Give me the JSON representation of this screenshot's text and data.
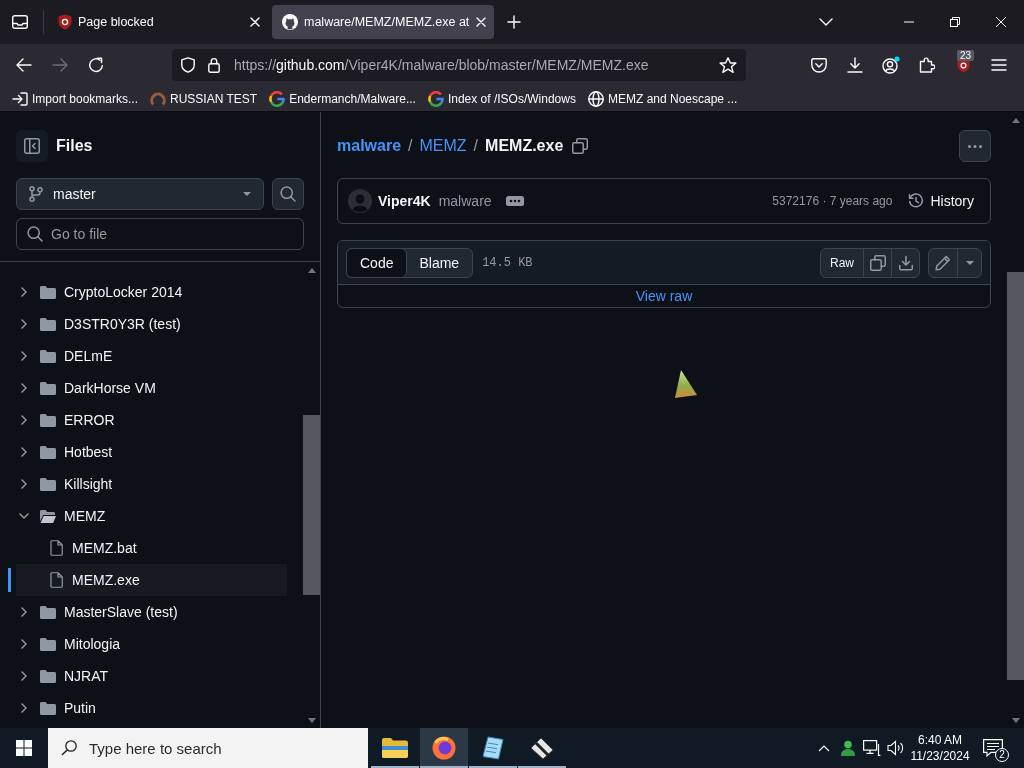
{
  "browser": {
    "tabs": [
      {
        "title": "Page blocked",
        "kind": "ublock",
        "selected": false
      },
      {
        "title": "malware/MEMZ/MEMZ.exe at",
        "kind": "github",
        "selected": true
      }
    ],
    "navigation": {
      "back_disabled": false,
      "forward_disabled": true
    },
    "address_bar": {
      "scheme": "https://",
      "host": "github.com",
      "path": "/Viper4K/malware/blob/master/MEMZ/MEMZ.exe"
    },
    "extension_badge": "23",
    "bookmarks": [
      {
        "label": "Import bookmarks...",
        "kind": "import"
      },
      {
        "label": "RUSSIAN TEST",
        "kind": "ring"
      },
      {
        "label": "Endermanch/Malware...",
        "kind": "google"
      },
      {
        "label": "Index of /ISOs/Windows",
        "kind": "google"
      },
      {
        "label": "MEMZ and Noescape ...",
        "kind": "globe"
      }
    ]
  },
  "sidebar": {
    "title": "Files",
    "branch": "master",
    "file_search": {
      "placeholder": "Go to file"
    },
    "tree": [
      {
        "name": "CryptoLocker 2014",
        "kind": "folder",
        "expanded": false,
        "selected": false
      },
      {
        "name": "D3STR0Y3R (test)",
        "kind": "folder",
        "expanded": false,
        "selected": false
      },
      {
        "name": "DELmE",
        "kind": "folder",
        "expanded": false,
        "selected": false
      },
      {
        "name": "DarkHorse VM",
        "kind": "folder",
        "expanded": false,
        "selected": false
      },
      {
        "name": "ERROR",
        "kind": "folder",
        "expanded": false,
        "selected": false
      },
      {
        "name": "Hotbest",
        "kind": "folder",
        "expanded": false,
        "selected": false
      },
      {
        "name": "Killsight",
        "kind": "folder",
        "expanded": false,
        "selected": false
      },
      {
        "name": "MEMZ",
        "kind": "folder",
        "expanded": true,
        "selected": false,
        "children": [
          {
            "name": "MEMZ.bat",
            "kind": "file",
            "selected": false
          },
          {
            "name": "MEMZ.exe",
            "kind": "file",
            "selected": true
          }
        ]
      },
      {
        "name": "MasterSlave (test)",
        "kind": "folder",
        "expanded": false,
        "selected": false
      },
      {
        "name": "Mitologia",
        "kind": "folder",
        "expanded": false,
        "selected": false
      },
      {
        "name": "NJRAT",
        "kind": "folder",
        "expanded": false,
        "selected": false
      },
      {
        "name": "Putin",
        "kind": "folder",
        "expanded": false,
        "selected": false
      }
    ]
  },
  "file_view": {
    "breadcrumb": [
      {
        "label": "malware",
        "kind": "repo"
      },
      {
        "label": "/",
        "kind": "separator"
      },
      {
        "label": "MEMZ",
        "kind": "folder"
      },
      {
        "label": "/",
        "kind": "separator"
      },
      {
        "label": "MEMZ.exe",
        "kind": "file"
      }
    ],
    "commit": {
      "author": "Viper4K",
      "repository": "malware",
      "hash_and_age": "5372176 · 7 years ago",
      "history": "History"
    },
    "view_tabs": [
      {
        "label": "Code",
        "selected": true
      },
      {
        "label": "Blame",
        "selected": false
      }
    ],
    "file_size": "14.5 KB",
    "raw_button": "Raw",
    "view_raw_link": "View raw"
  },
  "taskbar": {
    "search": {
      "placeholder": "Type here to search"
    },
    "apps": [
      {
        "kind": "explorer",
        "running": true,
        "selected": false
      },
      {
        "kind": "firefox",
        "running": true,
        "selected": true
      },
      {
        "kind": "notepad",
        "running": true,
        "selected": false
      },
      {
        "kind": "tool",
        "running": true,
        "selected": false
      }
    ],
    "time": "6:40 AM",
    "date": "11/23/2024",
    "notification_count": "2"
  }
}
